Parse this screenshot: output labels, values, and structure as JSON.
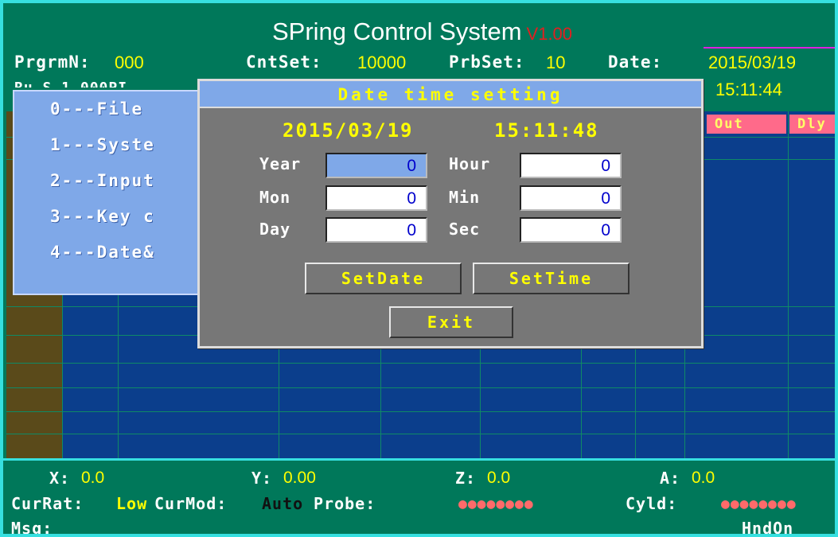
{
  "header": {
    "title": "SPring Control System",
    "version": "V1.00",
    "program_label": "PrgrmN:",
    "program_value": "000",
    "cntset_label": "CntSet:",
    "cntset_value": "10000",
    "prbset_label": "PrbSet:",
    "prbset_value": "10",
    "date_label": "Date:",
    "date_value": "2015/03/19",
    "time_value": "15:11:44",
    "partial_label": "Ru S 1 000PI"
  },
  "table": {
    "col_out": "Out",
    "col_dly": "Dly"
  },
  "menu": {
    "items": [
      {
        "label": "0---File"
      },
      {
        "label": "1---Syste"
      },
      {
        "label": "2---Input"
      },
      {
        "label": "3---Key c"
      },
      {
        "label": "4---Date&"
      }
    ]
  },
  "dialog": {
    "title": "Date time setting",
    "current_date": "2015/03/19",
    "current_time": "15:11:48",
    "fields": {
      "year_label": "Year",
      "year_value": "0",
      "mon_label": "Mon",
      "mon_value": "0",
      "day_label": "Day",
      "day_value": "0",
      "hour_label": "Hour",
      "hour_value": "0",
      "min_label": "Min",
      "min_value": "0",
      "sec_label": "Sec",
      "sec_value": "0"
    },
    "buttons": {
      "set_date": "SetDate",
      "set_time": "SetTime",
      "exit": "Exit"
    }
  },
  "status": {
    "x_label": "X:",
    "x_value": "0.0",
    "y_label": "Y:",
    "y_value": "0.00",
    "z_label": "Z:",
    "z_value": "0.0",
    "a_label": "A:",
    "a_value": "0.0",
    "currat_label": "CurRat:",
    "currat_value": "Low",
    "curmod_label": "CurMod:",
    "curmod_value": "Auto",
    "probe_label": "Probe:",
    "probe_indicators": "●●●●●●●●",
    "cyld_label": "Cyld:",
    "cyld_indicators": "●●●●●●●●",
    "msg_label": "Msg:",
    "hnd_status": "HndOn"
  },
  "colors": {
    "background": "#00785a",
    "table": "#0b3e8c",
    "dialog": "#777777",
    "accent_blue": "#7fa8e8",
    "text_yellow": "#ffff00",
    "indicator": "#ff6a6a"
  }
}
